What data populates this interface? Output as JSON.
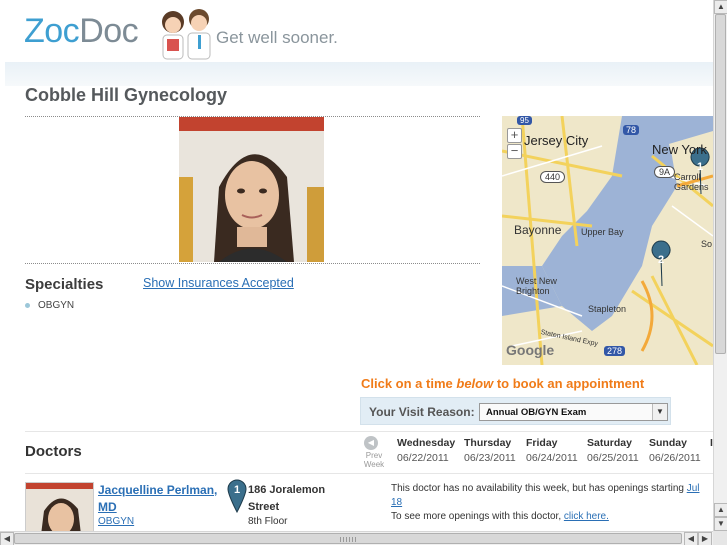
{
  "header": {
    "logo_zoc": "Zoc",
    "logo_doc": "Doc",
    "tagline": "Get well sooner."
  },
  "practice": {
    "title": "Cobble Hill Gynecology",
    "specialties_title": "Specialties",
    "insurance_link": "Show Insurances Accepted",
    "specialties": [
      "OBGYN"
    ]
  },
  "map": {
    "labels": {
      "jersey_city": "Jersey City",
      "new_york": "New York",
      "bayonne": "Bayonne",
      "upper_bay": "Upper Bay",
      "west_new_brighton": "West New\nBrighton",
      "stapleton": "Stapleton",
      "carroll_gardens": "Carroll\nGardens",
      "so": "So",
      "google": "Google",
      "staten_island_expy": "Staten Island Expy",
      "road_440": "440",
      "road_9a": "9A",
      "road_78": "78",
      "road_278": "278",
      "road_95": "95",
      "pin_1": "1",
      "pin_2": "2"
    },
    "zoom_in": "+",
    "zoom_out": "−"
  },
  "booking": {
    "cta_before": "Click on a time ",
    "cta_em": "below",
    "cta_after": " to book an appointment",
    "reason_label": "Your Visit Reason:",
    "reason_value": "Annual OB/GYN Exam"
  },
  "schedule": {
    "doctors_title": "Doctors",
    "prev_label": "Prev\nWeek",
    "days": [
      {
        "name": "Wednesday",
        "date": "06/22/2011"
      },
      {
        "name": "Thursday",
        "date": "06/23/2011"
      },
      {
        "name": "Friday",
        "date": "06/24/2011"
      },
      {
        "name": "Saturday",
        "date": "06/25/2011"
      },
      {
        "name": "Sunday",
        "date": "06/26/2011"
      },
      {
        "name": "I",
        "date": ""
      }
    ]
  },
  "doctor": {
    "name": "Jacquelline Perlman, MD",
    "specialty": "OBGYN",
    "pin_number": "1",
    "address_line1": "186 Joralemon Street",
    "address_line2": "8th Floor",
    "availability_text": "This doctor has no availability this week, but has openings starting ",
    "availability_link": "Jul 18",
    "more_text": "To see more openings with this doctor, ",
    "more_link": "click here."
  },
  "colors": {
    "brand_blue": "#3e9fd1",
    "link_blue": "#2a6fb5",
    "cta_orange": "#f07b18"
  }
}
